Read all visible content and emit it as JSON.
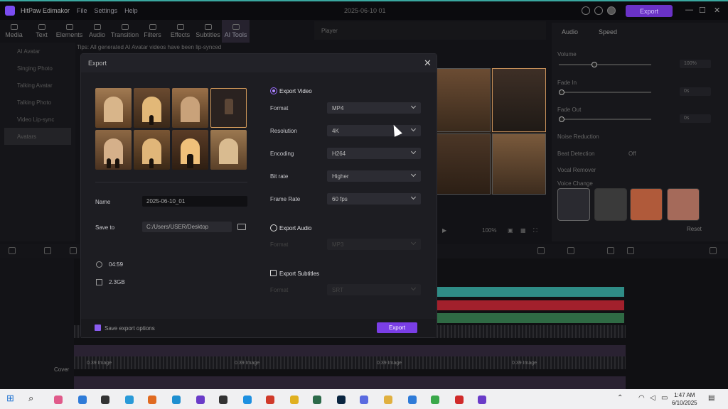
{
  "titlebar": {
    "app_name": "HitPaw Edimakor",
    "menu_file": "File",
    "menu_settings": "Settings",
    "menu_help": "Help",
    "doc_title": "2025-06-10 01",
    "export_label": "Export"
  },
  "toolbar": [
    "Media",
    "Text",
    "Elements",
    "Audio",
    "Transition",
    "Filters",
    "Effects",
    "Subtitles",
    "AI Tools"
  ],
  "left_panel": [
    "AI Avatar",
    "Singing Photo",
    "Talking Avatar",
    "Talking Photo",
    "Video Lip-sync",
    "Avatars"
  ],
  "tips": "Tips: All generated AI Avatar videos have been lip-synced",
  "player": {
    "label": "Player",
    "zoom": "100%"
  },
  "right_panel": {
    "tab_audio": "Audio",
    "tab_speed": "Speed",
    "volume": "Volume",
    "volume_value": "100%",
    "fade_in": "Fade In",
    "fade_in_value": "0s",
    "fade_out": "Fade Out",
    "fade_out_value": "0s",
    "noise_reduction": "Noise Reduction",
    "beat_detection": "Beat Detection",
    "beat_value": "Off",
    "vocal_remover": "Vocal Remover",
    "voice_change": "Voice Change",
    "reset": "Reset"
  },
  "dialog": {
    "title": "Export",
    "name_label": "Name",
    "name_value": "2025-06-10_01",
    "save_label": "Save to",
    "save_value": "C:/Users/USER/Desktop",
    "duration": "04:59",
    "size": "2.3GB",
    "export_video": "Export Video",
    "format_label": "Format",
    "format_value": "MP4",
    "resolution_label": "Resolution",
    "resolution_value": "4K",
    "encoding_label": "Encoding",
    "encoding_value": "H264",
    "bitrate_label": "Bit rate",
    "bitrate_value": "Higher",
    "framerate_label": "Frame Rate",
    "framerate_value": "60  fps",
    "export_audio": "Export Audio",
    "audio_format_label": "Format",
    "audio_format_value": "MP3",
    "export_subtitles": "Export Subtitles",
    "sub_format_label": "Format",
    "sub_format_value": "SRT",
    "save_options": "Save export options",
    "export_button": "Export"
  },
  "timeline": {
    "cover": "Cover",
    "clip_label": "0.39 Image"
  },
  "taskbar": {
    "time": "1:47 AM",
    "date": "6/10/2025"
  },
  "colors": {
    "accent": "#7a3ee6",
    "teal": "#2f8c86",
    "red": "#a2202c",
    "green": "#2f6a44"
  }
}
